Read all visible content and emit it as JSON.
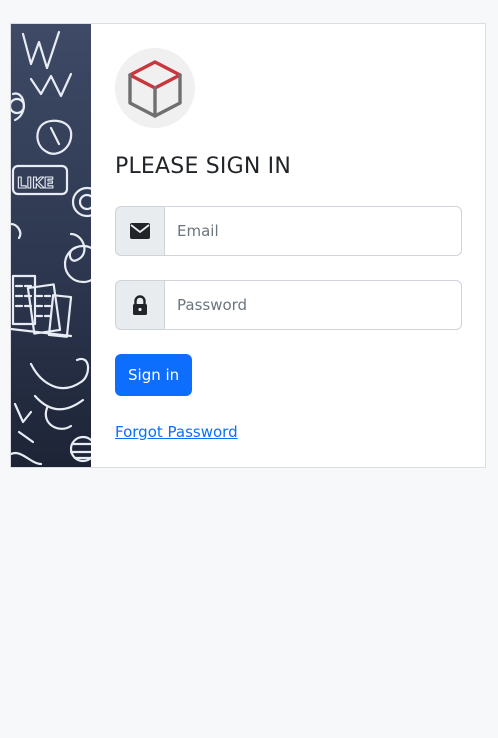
{
  "auth": {
    "title": "PLEASE SIGN IN",
    "email_placeholder": "Email",
    "password_placeholder": "Password",
    "submit_label": "Sign in",
    "forgot_label": "Forgot Password"
  },
  "decor": {
    "sticker_text": "LIKE"
  },
  "icons": {
    "logo": "cube-icon",
    "email": "envelope-icon",
    "password": "lock-icon"
  },
  "colors": {
    "primary": "#0d6efd",
    "logo_accent": "#c8373d",
    "logo_body": "#6f6f6f",
    "side_panel": "#2f3a52"
  }
}
